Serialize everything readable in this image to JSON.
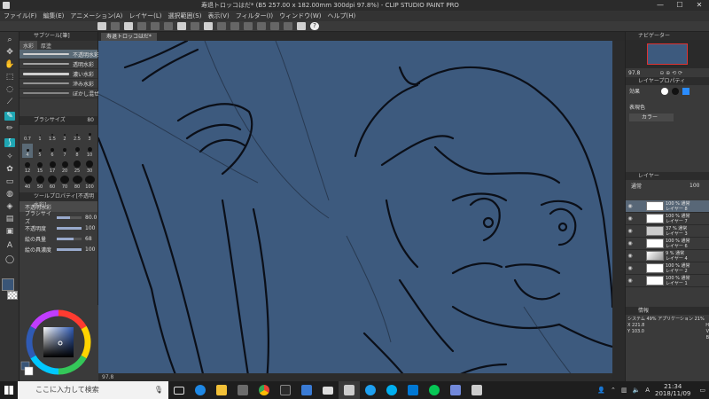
{
  "window": {
    "title": "寿退トロッコはだ* (B5 257.00 x 182.00mm 300dpi 97.8%) - CLIP STUDIO PAINT PRO",
    "minimize": "—",
    "maximize": "☐",
    "close": "✕"
  },
  "menu": {
    "items": [
      "ファイル(F)",
      "編集(E)",
      "アニメーション(A)",
      "レイヤー(L)",
      "選択範囲(S)",
      "表示(V)",
      "フィルター(I)",
      "ウィンドウ(W)",
      "ヘルプ(H)"
    ]
  },
  "subtool_panel": {
    "header": "サブツール[筆]",
    "tabs": [
      "水彩",
      "厚塗"
    ],
    "brushes": [
      {
        "label": "不透明水彩"
      },
      {
        "label": "透明水彩"
      },
      {
        "label": "濃い水彩"
      },
      {
        "label": "滲み水彩"
      },
      {
        "label": "ぼかし混ぜ水"
      }
    ]
  },
  "brush_size_panel": {
    "header": "ブラシサイズ",
    "value": "80",
    "sizes": [
      "0.7",
      "1",
      "1.5",
      "2",
      "2.5",
      "3",
      "4",
      "5",
      "6",
      "7",
      "8",
      "10",
      "12",
      "15",
      "17",
      "20",
      "25",
      "30",
      "40",
      "50",
      "60",
      "70",
      "80",
      "100"
    ]
  },
  "tool_property": {
    "header": "ツールプロパティ[不透明水彩]",
    "name": "不透明水彩",
    "properties": [
      {
        "label": "ブラシサイズ",
        "value": "80.0",
        "level": 0.55
      },
      {
        "label": "不透明度",
        "value": "100",
        "level": 1.0
      },
      {
        "label": "絵の具量",
        "value": "68",
        "level": 0.68
      },
      {
        "label": "絵の具濃度",
        "value": "100",
        "level": 1.0
      }
    ]
  },
  "colors": {
    "main": "#395577",
    "canvas_bg": "#3d5a7e",
    "accent": "#1fa6b3"
  },
  "canvas": {
    "tab_label": "寿退トロッコはだ*",
    "zoom": "97.8"
  },
  "right_panel": {
    "navigator_header": "ナビゲーター",
    "nav_zoom": "97.8",
    "layer_prop_header": "レイヤープロパティ",
    "effect_label": "効果",
    "expression_color_label": "表現色",
    "expression_color_value": "カラー",
    "layer_header": "レイヤー",
    "blend_mode": "通常",
    "opacity": "100",
    "layers": [
      {
        "name": "100 % 通常\nレイヤー 8"
      },
      {
        "name": "100 % 通常\nレイヤー 7"
      },
      {
        "name": "37 % 通常\nレイヤー 3"
      },
      {
        "name": "100 % 通常\nレイヤー 6"
      },
      {
        "name": "9 % 通常\nレイヤー 4"
      },
      {
        "name": "100 % 通常\nレイヤー 2"
      },
      {
        "name": "100 % 通常\nレイヤー 1"
      }
    ],
    "info_header": "情報",
    "system_info": "システム 49%  アプリケーション 21%",
    "coord_x": "221.8",
    "coord_y": "103.0",
    "h_label": "H",
    "v_label": "V",
    "b_label": "B"
  },
  "taskbar": {
    "search_placeholder": "ここに入力して検索",
    "time": "21:34",
    "date": "2018/11/09",
    "lang": "A"
  }
}
